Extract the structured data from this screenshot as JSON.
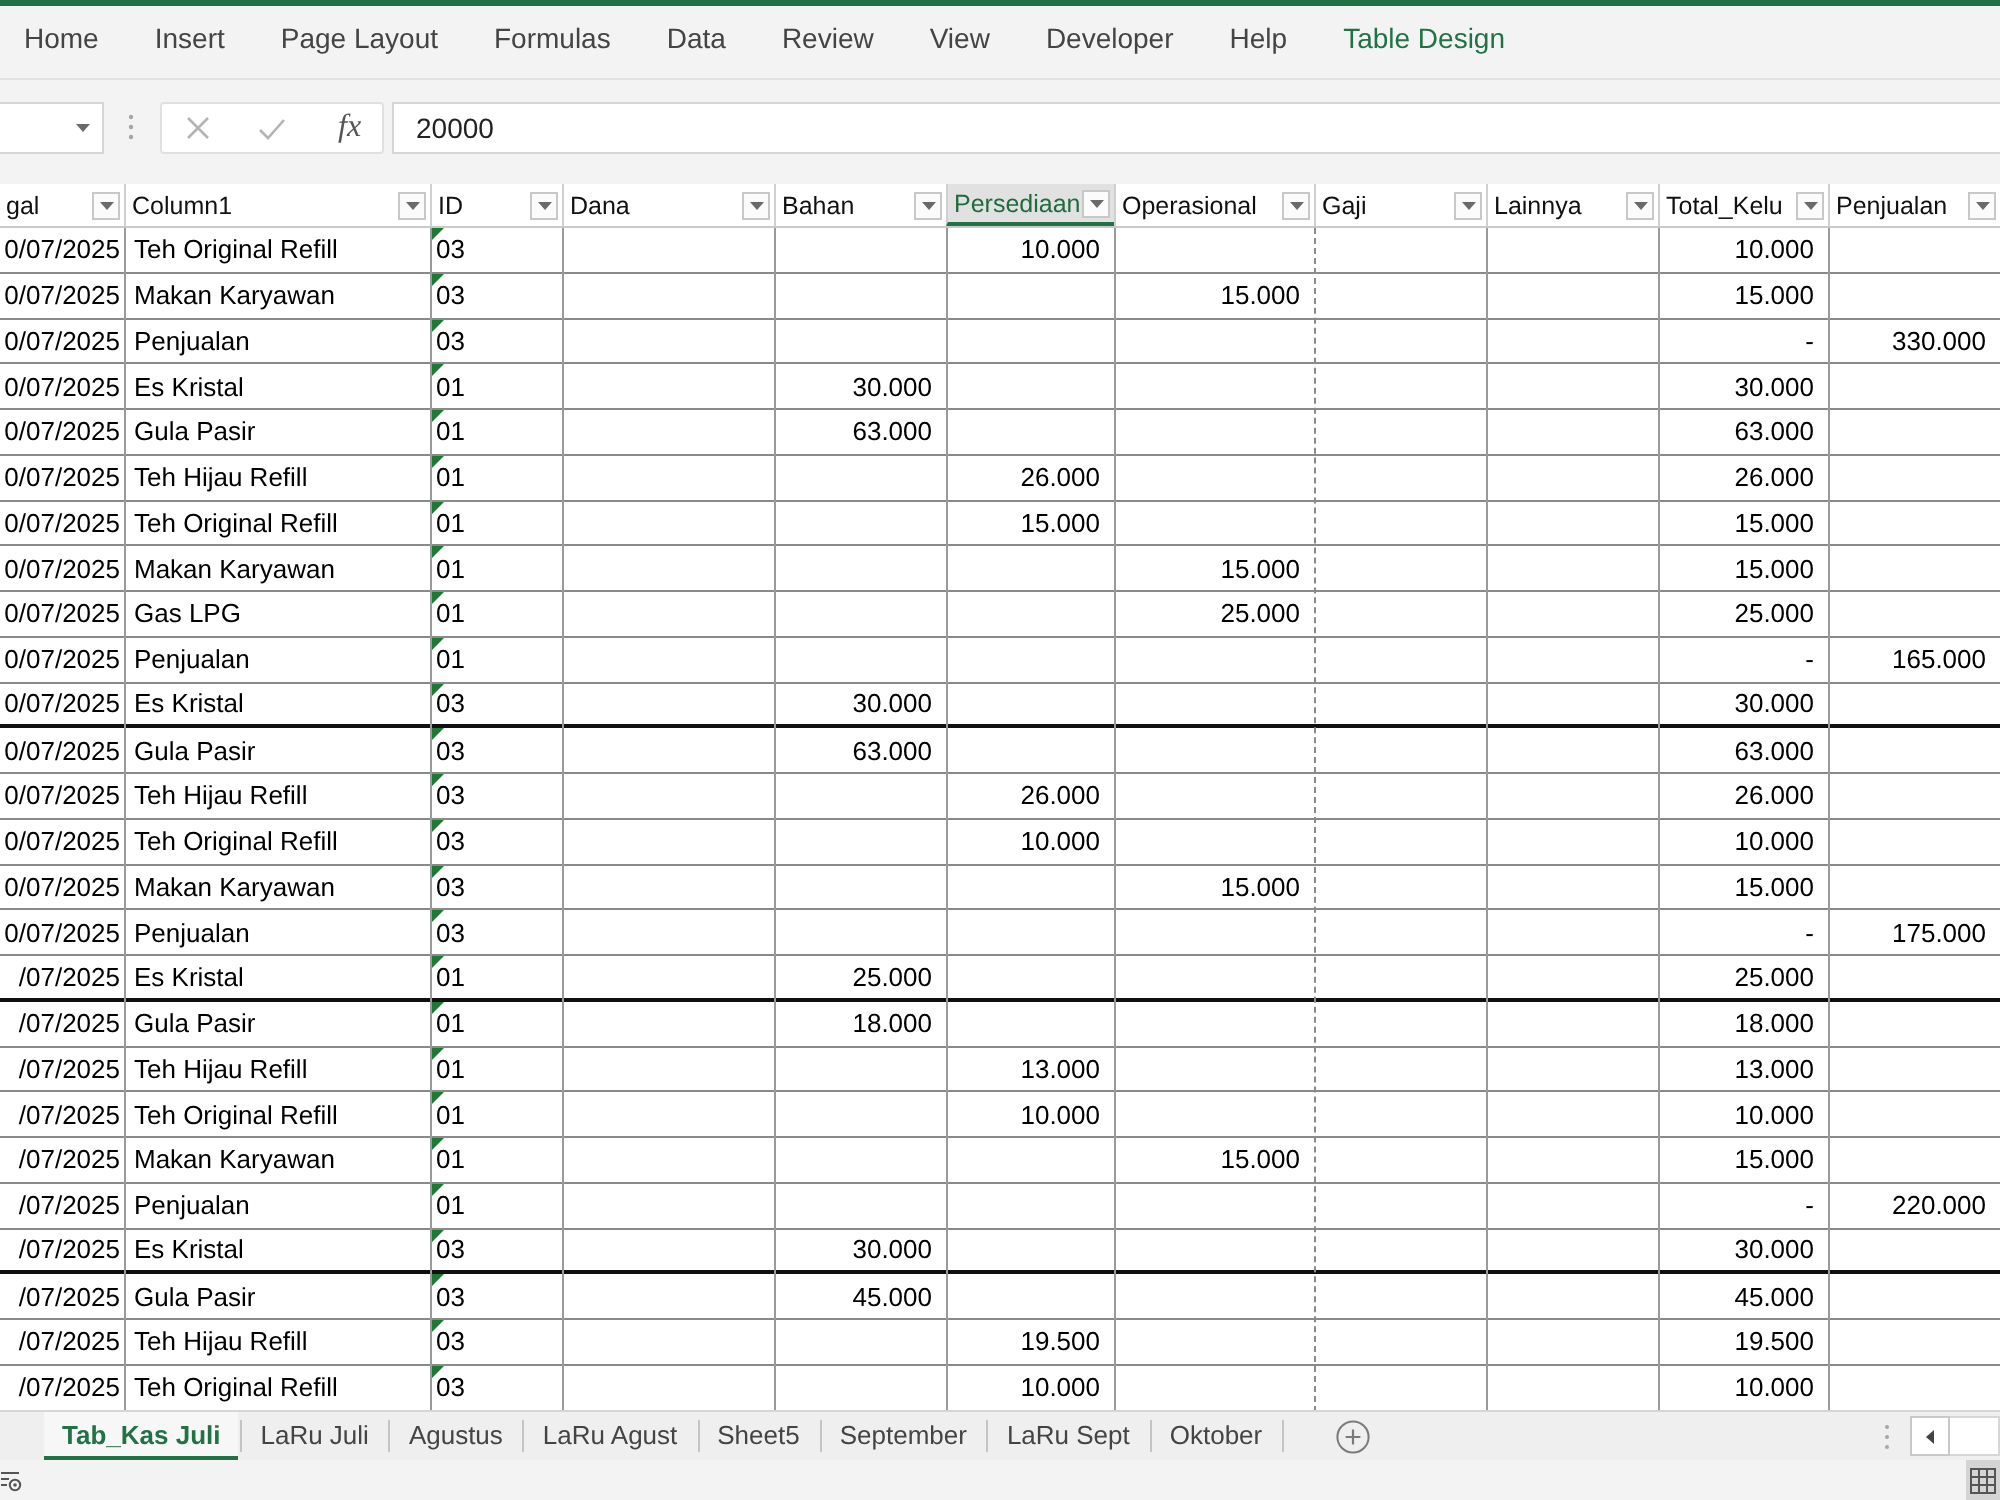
{
  "ribbon": {
    "tabs": [
      {
        "label": "Home",
        "kind": "standard",
        "selected": false
      },
      {
        "label": "Insert",
        "kind": "standard",
        "selected": false
      },
      {
        "label": "Page Layout",
        "kind": "standard",
        "selected": false
      },
      {
        "label": "Formulas",
        "kind": "standard",
        "selected": false
      },
      {
        "label": "Data",
        "kind": "standard",
        "selected": false
      },
      {
        "label": "Review",
        "kind": "standard",
        "selected": false
      },
      {
        "label": "View",
        "kind": "standard",
        "selected": false
      },
      {
        "label": "Developer",
        "kind": "standard",
        "selected": false
      },
      {
        "label": "Help",
        "kind": "standard",
        "selected": false
      },
      {
        "label": "Table Design",
        "kind": "contextual",
        "selected": false
      }
    ]
  },
  "formula_bar": {
    "actions": [
      {
        "kind": "cancel",
        "disabled": true
      },
      {
        "kind": "enter",
        "disabled": true
      }
    ],
    "function_label": "fx",
    "value": "20000"
  },
  "table": {
    "columns": [
      {
        "label": "gal",
        "selected": false,
        "page_break": false
      },
      {
        "label": "Column1",
        "selected": false,
        "page_break": false
      },
      {
        "label": "ID",
        "selected": false,
        "page_break": false
      },
      {
        "label": "Dana",
        "selected": false,
        "page_break": false
      },
      {
        "label": "Bahan",
        "selected": false,
        "page_break": false
      },
      {
        "label": "Persediaan",
        "selected": true,
        "page_break": false
      },
      {
        "label": "Operasional",
        "selected": false,
        "page_break": false
      },
      {
        "label": "Gaji",
        "selected": false,
        "page_break": true
      },
      {
        "label": "Lainnya",
        "selected": false,
        "page_break": false
      },
      {
        "label": "Total_Kelu",
        "selected": false,
        "page_break": false
      },
      {
        "label": "Penjualan",
        "selected": false,
        "page_break": false
      }
    ],
    "rows": [
      {
        "date": "0/07/2025",
        "item": "Teh Original Refill",
        "id": "03",
        "persediaan": "10.000",
        "total_kelu": "10.000",
        "id_warning": true,
        "group_end": false
      },
      {
        "date": "0/07/2025",
        "item": "Makan Karyawan",
        "id": "03",
        "operasional": "15.000",
        "total_kelu": "15.000",
        "id_warning": true,
        "group_end": false
      },
      {
        "date": "0/07/2025",
        "item": "Penjualan",
        "id": "03",
        "total_kelu": "-",
        "penjualan": "330.000",
        "id_warning": true,
        "group_end": false
      },
      {
        "date": "0/07/2025",
        "item": "Es Kristal",
        "id": "01",
        "bahan": "30.000",
        "total_kelu": "30.000",
        "id_warning": true,
        "group_end": false
      },
      {
        "date": "0/07/2025",
        "item": "Gula Pasir",
        "id": "01",
        "bahan": "63.000",
        "total_kelu": "63.000",
        "id_warning": true,
        "group_end": false
      },
      {
        "date": "0/07/2025",
        "item": "Teh Hijau Refill",
        "id": "01",
        "persediaan": "26.000",
        "total_kelu": "26.000",
        "id_warning": true,
        "group_end": false
      },
      {
        "date": "0/07/2025",
        "item": "Teh Original Refill",
        "id": "01",
        "persediaan": "15.000",
        "total_kelu": "15.000",
        "id_warning": true,
        "group_end": false
      },
      {
        "date": "0/07/2025",
        "item": "Makan Karyawan",
        "id": "01",
        "operasional": "15.000",
        "total_kelu": "15.000",
        "id_warning": true,
        "group_end": false
      },
      {
        "date": "0/07/2025",
        "item": "Gas LPG",
        "id": "01",
        "operasional": "25.000",
        "total_kelu": "25.000",
        "id_warning": true,
        "group_end": false
      },
      {
        "date": "0/07/2025",
        "item": "Penjualan",
        "id": "01",
        "total_kelu": "-",
        "penjualan": "165.000",
        "id_warning": true,
        "group_end": false
      },
      {
        "date": "0/07/2025",
        "item": "Es Kristal",
        "id": "03",
        "bahan": "30.000",
        "total_kelu": "30.000",
        "id_warning": true,
        "group_end": true
      },
      {
        "date": "0/07/2025",
        "item": "Gula Pasir",
        "id": "03",
        "bahan": "63.000",
        "total_kelu": "63.000",
        "id_warning": true,
        "group_end": false
      },
      {
        "date": "0/07/2025",
        "item": "Teh Hijau Refill",
        "id": "03",
        "persediaan": "26.000",
        "total_kelu": "26.000",
        "id_warning": true,
        "group_end": false
      },
      {
        "date": "0/07/2025",
        "item": "Teh Original Refill",
        "id": "03",
        "persediaan": "10.000",
        "total_kelu": "10.000",
        "id_warning": true,
        "group_end": false
      },
      {
        "date": "0/07/2025",
        "item": "Makan Karyawan",
        "id": "03",
        "operasional": "15.000",
        "total_kelu": "15.000",
        "id_warning": true,
        "group_end": false
      },
      {
        "date": "0/07/2025",
        "item": "Penjualan",
        "id": "03",
        "total_kelu": "-",
        "penjualan": "175.000",
        "id_warning": true,
        "group_end": false
      },
      {
        "date": "/07/2025",
        "item": "Es Kristal",
        "id": "01",
        "bahan": "25.000",
        "total_kelu": "25.000",
        "id_warning": true,
        "group_end": true
      },
      {
        "date": "/07/2025",
        "item": "Gula Pasir",
        "id": "01",
        "bahan": "18.000",
        "total_kelu": "18.000",
        "id_warning": true,
        "group_end": false
      },
      {
        "date": "/07/2025",
        "item": "Teh Hijau Refill",
        "id": "01",
        "persediaan": "13.000",
        "total_kelu": "13.000",
        "id_warning": true,
        "group_end": false
      },
      {
        "date": "/07/2025",
        "item": "Teh Original Refill",
        "id": "01",
        "persediaan": "10.000",
        "total_kelu": "10.000",
        "id_warning": true,
        "group_end": false
      },
      {
        "date": "/07/2025",
        "item": "Makan Karyawan",
        "id": "01",
        "operasional": "15.000",
        "total_kelu": "15.000",
        "id_warning": true,
        "group_end": false
      },
      {
        "date": "/07/2025",
        "item": "Penjualan",
        "id": "01",
        "total_kelu": "-",
        "penjualan": "220.000",
        "id_warning": true,
        "group_end": false
      },
      {
        "date": "/07/2025",
        "item": "Es Kristal",
        "id": "03",
        "bahan": "30.000",
        "total_kelu": "30.000",
        "id_warning": true,
        "group_end": true
      },
      {
        "date": "/07/2025",
        "item": "Gula Pasir",
        "id": "03",
        "bahan": "45.000",
        "total_kelu": "45.000",
        "id_warning": true,
        "group_end": false
      },
      {
        "date": "/07/2025",
        "item": "Teh Hijau Refill",
        "id": "03",
        "persediaan": "19.500",
        "total_kelu": "19.500",
        "id_warning": true,
        "group_end": false
      },
      {
        "date": "/07/2025",
        "item": "Teh Original Refill",
        "id": "03",
        "persediaan": "10.000",
        "total_kelu": "10.000",
        "id_warning": true,
        "group_end": false
      }
    ]
  },
  "sheet_tabs": [
    {
      "label": "Tab_Kas Juli",
      "selected": true
    },
    {
      "label": "LaRu Juli",
      "selected": false
    },
    {
      "label": "Agustus",
      "selected": false
    },
    {
      "label": "LaRu Agust",
      "selected": false
    },
    {
      "label": "Sheet5",
      "selected": false
    },
    {
      "label": "September",
      "selected": false
    },
    {
      "label": "LaRu Sept",
      "selected": false
    },
    {
      "label": "Oktober",
      "selected": false
    }
  ],
  "status_bar": {
    "views": [
      {
        "kind": "normal",
        "selected": true
      }
    ]
  }
}
